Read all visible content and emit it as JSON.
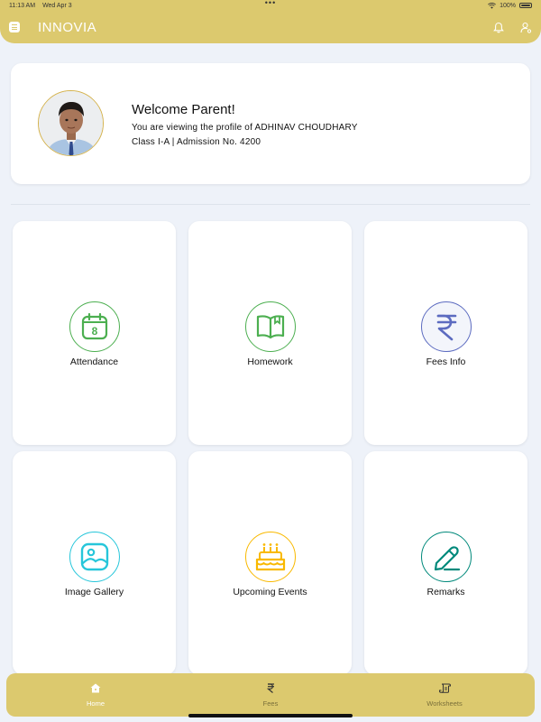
{
  "status_bar": {
    "time": "11:13 AM",
    "date": "Wed Apr 3",
    "dots": "•••",
    "battery_percent": "100%"
  },
  "header": {
    "app_title": "INNOVIA",
    "menu_icon": "menu-icon",
    "bell_icon": "bell-icon",
    "user_icon": "user-settings-icon"
  },
  "profile": {
    "welcome": "Welcome Parent!",
    "viewing_text": "You are viewing the profile of ADHINAV CHOUDHARY",
    "class_text": "Class I-A | Admission No. 4200"
  },
  "tiles": [
    {
      "label": "Attendance",
      "icon": "calendar-icon",
      "color": "#4caf50"
    },
    {
      "label": "Homework",
      "icon": "book-icon",
      "color": "#4caf50"
    },
    {
      "label": "Fees Info",
      "icon": "rupee-icon",
      "color": "#5c6bc0"
    },
    {
      "label": "Image Gallery",
      "icon": "image-icon",
      "color": "#26c6da"
    },
    {
      "label": "Upcoming Events",
      "icon": "cake-icon",
      "color": "#f9b900"
    },
    {
      "label": "Remarks",
      "icon": "pen-icon",
      "color": "#00897b"
    }
  ],
  "bottom_nav": {
    "items": [
      {
        "label": "Home",
        "icon": "home-icon",
        "active": true
      },
      {
        "label": "Fees",
        "icon": "rupee-icon",
        "active": false
      },
      {
        "label": "Worksheets",
        "icon": "scroll-icon",
        "active": false
      }
    ]
  },
  "colors": {
    "accent": "#dcc96e",
    "background": "#eef2f9",
    "avatar_border": "#d4b24c"
  }
}
